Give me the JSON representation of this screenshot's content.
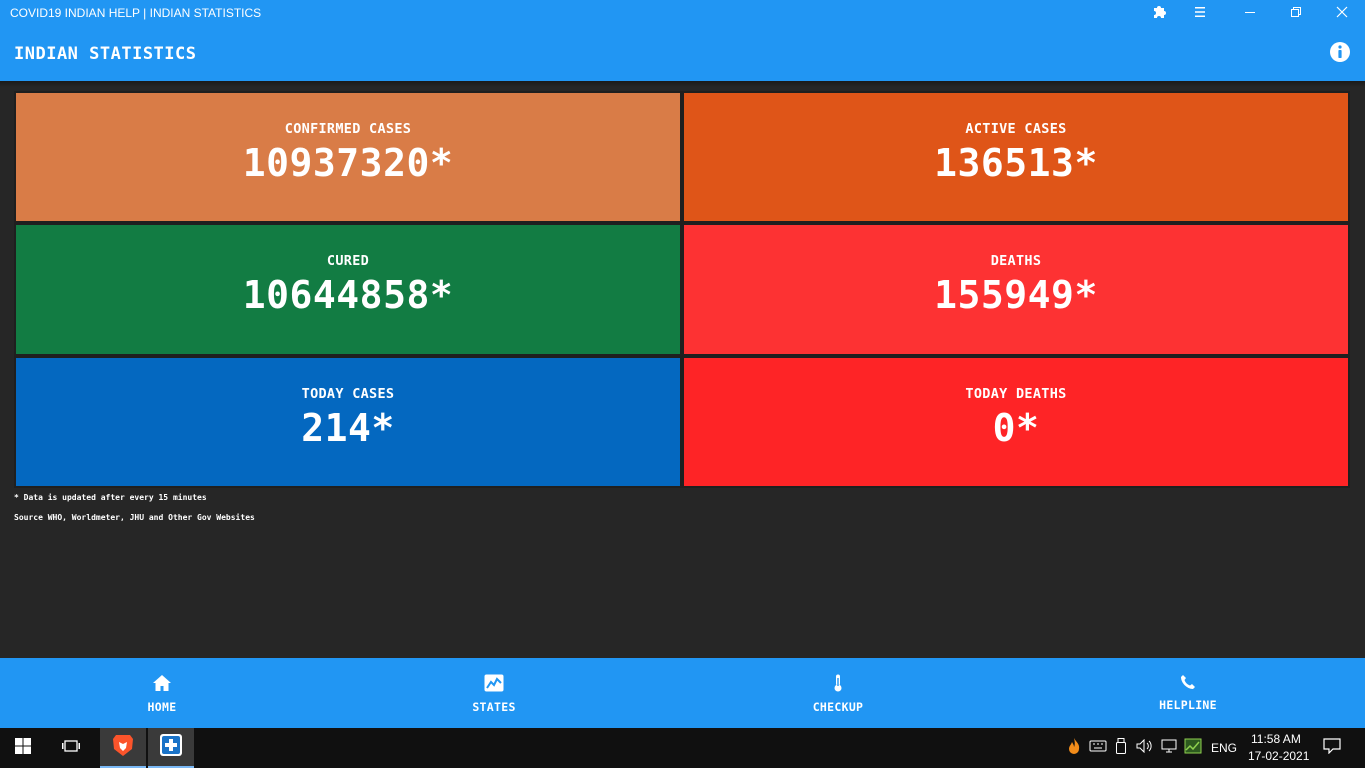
{
  "window": {
    "title": "COVID19 INDIAN HELP | INDIAN STATISTICS",
    "controls": [
      "extension-icon",
      "menu-icon",
      "minimize-icon",
      "restore-icon",
      "close-icon"
    ]
  },
  "appbar": {
    "title": "INDIAN STATISTICS",
    "info_icon": "info-icon"
  },
  "stats": [
    {
      "label": "CONFIRMED CASES",
      "value": "10937320*",
      "color": "#d97c47"
    },
    {
      "label": "ACTIVE CASES",
      "value": "136513*",
      "color": "#df5518"
    },
    {
      "label": "CURED",
      "value": "10644858*",
      "color": "#127c43"
    },
    {
      "label": "DEATHS",
      "value": "155949*",
      "color": "#fd3233"
    },
    {
      "label": "TODAY CASES",
      "value": "214*",
      "color": "#0468c0"
    },
    {
      "label": "TODAY DEATHS",
      "value": "0*",
      "color": "#fe2426"
    }
  ],
  "notes": {
    "update": "* Data is updated after every 15 minutes",
    "source": "Source WHO, Worldmeter, JHU and Other Gov Websites"
  },
  "nav": [
    {
      "label": "HOME",
      "icon": "home-icon"
    },
    {
      "label": "STATES",
      "icon": "chart-icon"
    },
    {
      "label": "CHECKUP",
      "icon": "thermometer-icon"
    },
    {
      "label": "HELPLINE",
      "icon": "phone-icon"
    }
  ],
  "taskbar": {
    "language": "ENG",
    "time": "11:58 AM",
    "date": "17-02-2021"
  },
  "colors": {
    "primary": "#2196f3",
    "background": "#262626",
    "taskbar": "#101010"
  }
}
